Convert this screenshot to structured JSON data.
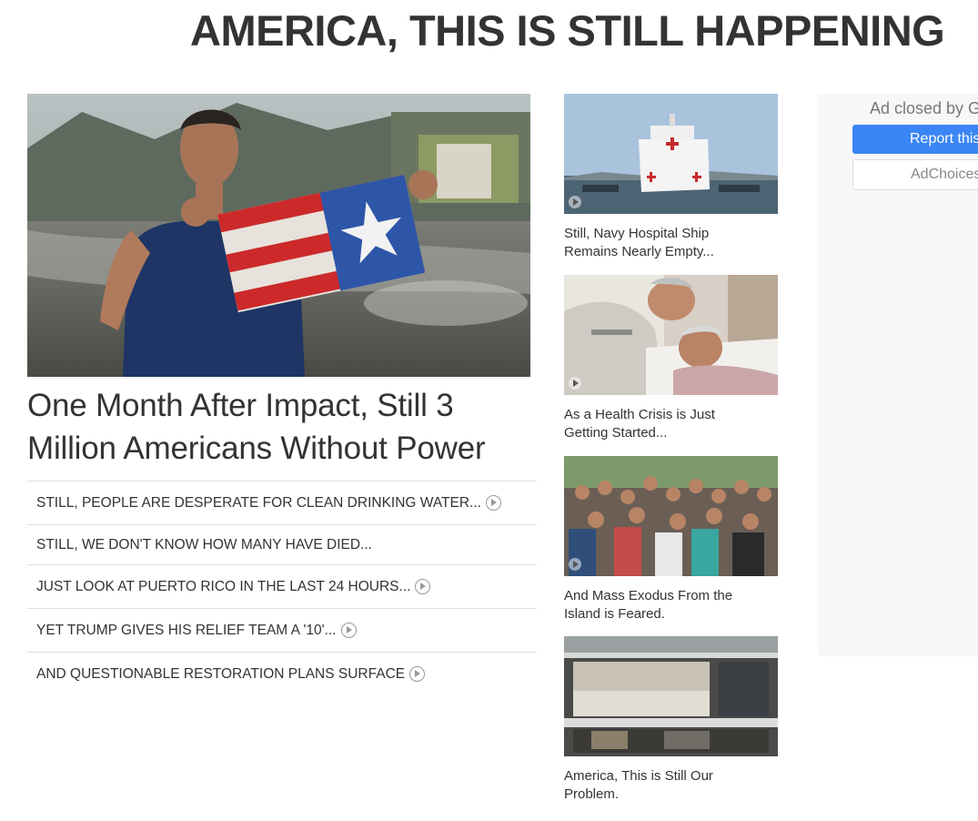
{
  "page": {
    "title": "AMERICA, THIS IS STILL HAPPENING"
  },
  "hero": {
    "headline": "One Month After Impact, Still 3 Million Americans Without Power",
    "image_icon": "play-icon"
  },
  "stories": [
    {
      "label": "STILL, PEOPLE ARE DESPERATE FOR CLEAN DRINKING WATER...",
      "has_video": true
    },
    {
      "label": "STILL, WE DON'T KNOW HOW MANY HAVE DIED...",
      "has_video": false
    },
    {
      "label": "JUST LOOK AT PUERTO RICO IN THE LAST 24 HOURS...",
      "has_video": true
    },
    {
      "label": "YET TRUMP GIVES HIS RELIEF TEAM A '10'...",
      "has_video": true
    },
    {
      "label": "AND QUESTIONABLE RESTORATION PLANS SURFACE",
      "has_video": true
    }
  ],
  "cards": [
    {
      "caption": "Still, Navy Hospital Ship Remains Nearly Empty...",
      "has_video": true
    },
    {
      "caption": "As a Health Crisis is Just Getting Started...",
      "has_video": true
    },
    {
      "caption": "And Mass Exodus From the Island is Feared.",
      "has_video": true
    },
    {
      "caption": "America, This is Still Our Problem.",
      "has_video": false
    }
  ],
  "ad": {
    "closed_text": "Ad closed by Google",
    "report_label": "Report this ad",
    "choices_label": "AdChoices"
  },
  "colors": {
    "title_text": "#333333",
    "report_button": "#3b86f4",
    "ad_background": "#f7f7f7",
    "divider": "#dddddd"
  }
}
